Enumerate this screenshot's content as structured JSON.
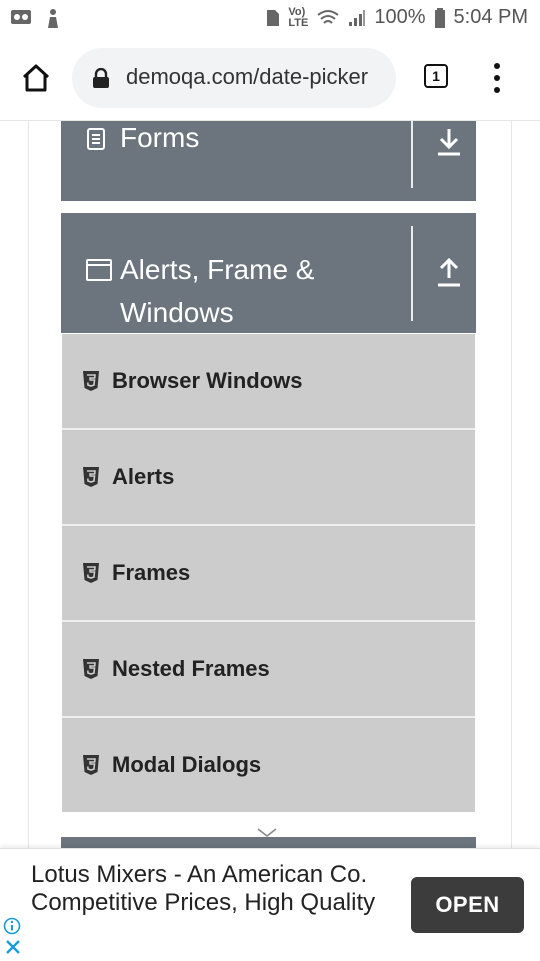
{
  "status_bar": {
    "battery": "100%",
    "time": "5:04 PM",
    "network": "LTE"
  },
  "browser": {
    "url": "demoqa.com/date-picker",
    "tab_count": "1"
  },
  "sidebar": {
    "forms_group": {
      "title": "Forms",
      "icon": "list-icon",
      "toggle": "expand-down-icon"
    },
    "alerts_group": {
      "title_line1": "Alerts, Frame &",
      "title_line2": "Windows",
      "icon": "window-icon",
      "toggle": "collapse-up-icon"
    },
    "items": [
      {
        "label": "Browser Windows"
      },
      {
        "label": "Alerts"
      },
      {
        "label": "Frames"
      },
      {
        "label": "Nested Frames"
      },
      {
        "label": "Modal Dialogs"
      }
    ]
  },
  "ad": {
    "text": "Lotus Mixers - An American Co. Competitive Prices, High Quality",
    "button": "OPEN"
  },
  "colors": {
    "header_bg": "#6c757d",
    "item_bg": "#cccccc",
    "ad_button_bg": "#3c3c3c"
  }
}
